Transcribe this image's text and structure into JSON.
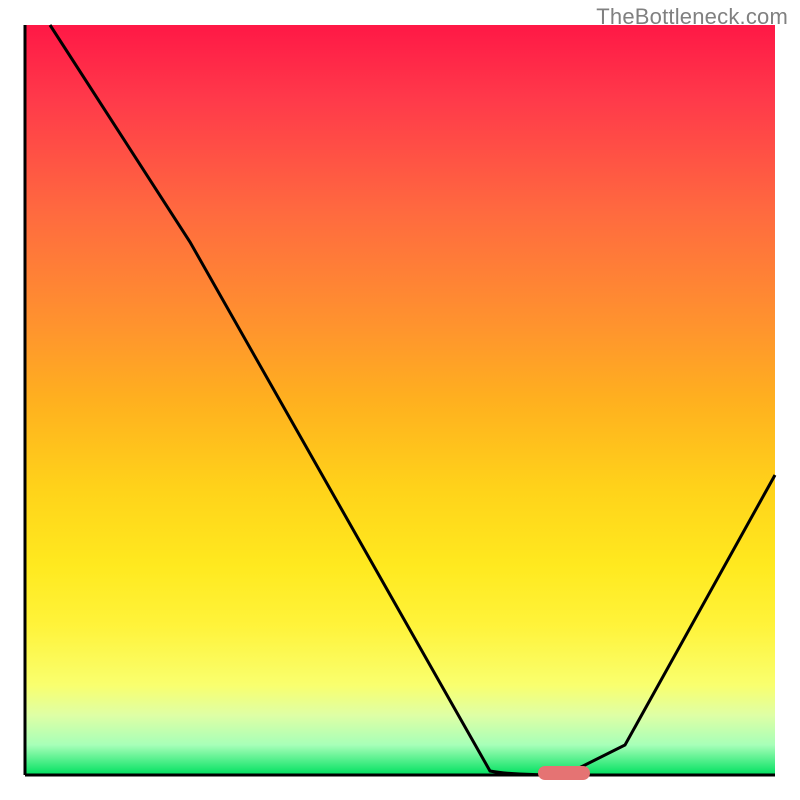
{
  "watermark": "TheBottleneck.com",
  "chart_data": {
    "type": "line",
    "title": "",
    "xlabel": "",
    "ylabel": "",
    "xlim": [
      0,
      100
    ],
    "ylim": [
      0,
      100
    ],
    "grid": false,
    "x": [
      3.3,
      22,
      62,
      72,
      80,
      100
    ],
    "y": [
      100,
      71,
      0.5,
      0,
      4,
      40
    ],
    "marker": {
      "x": 72,
      "y": 0,
      "color": "#e57373"
    },
    "background_gradient": {
      "top_color": "#ff1846",
      "bottom_color": "#00e060",
      "stops": [
        {
          "pos": 0,
          "color": "#ff1846"
        },
        {
          "pos": 40,
          "color": "#ff932e"
        },
        {
          "pos": 75,
          "color": "#ffe91f"
        },
        {
          "pos": 100,
          "color": "#00e060"
        }
      ]
    }
  }
}
